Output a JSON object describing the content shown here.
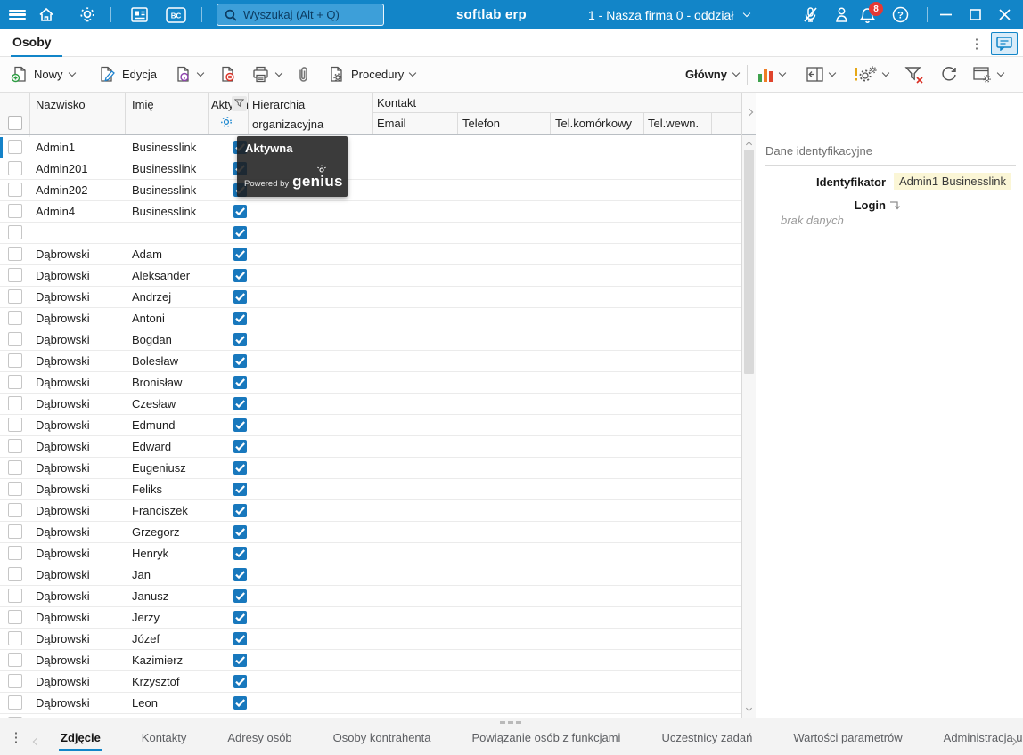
{
  "colors": {
    "topbar_blue": "#1285c8",
    "accent_blue": "#1285c8",
    "checkbox_blue": "#1878bd",
    "highlight_yellow": "#fbf6d6",
    "badge_red": "#e53935",
    "tooltip_bg": "rgba(30,30,30,0.87)"
  },
  "topbar": {
    "brand": "softlab erp",
    "search_placeholder": "Wyszukaj (Alt + Q)",
    "company_selector": "1 - Nasza firma 0 - oddział",
    "notification_count": "8"
  },
  "tabrow": {
    "active_tab": "Osoby"
  },
  "toolbar": {
    "new_label": "Nowy",
    "edit_label": "Edycja",
    "procedures_label": "Procedury",
    "view_label": "Główny"
  },
  "grid": {
    "columns": {
      "nazwisko": "Nazwisko",
      "imie": "Imię",
      "aktywna": "Aktywn",
      "hierarchia_line1": "Hierarchia",
      "hierarchia_line2": "organizacyjna",
      "kontakt_group": "Kontakt",
      "email": "Email",
      "telefon": "Telefon",
      "tel_komorkowy": "Tel.komórkowy",
      "tel_wewn": "Tel.wewn."
    },
    "rows": [
      {
        "nazwisko": "Admin1",
        "imie": "Businesslink",
        "aktywna": true,
        "selected": true
      },
      {
        "nazwisko": "Admin201",
        "imie": "Businesslink",
        "aktywna": true
      },
      {
        "nazwisko": "Admin202",
        "imie": "Businesslink",
        "aktywna": true
      },
      {
        "nazwisko": "Admin4",
        "imie": "Businesslink",
        "aktywna": true
      },
      {
        "nazwisko": "",
        "imie": "",
        "aktywna": true
      },
      {
        "nazwisko": "Dąbrowski",
        "imie": "Adam",
        "aktywna": true
      },
      {
        "nazwisko": "Dąbrowski",
        "imie": "Aleksander",
        "aktywna": true
      },
      {
        "nazwisko": "Dąbrowski",
        "imie": "Andrzej",
        "aktywna": true
      },
      {
        "nazwisko": "Dąbrowski",
        "imie": "Antoni",
        "aktywna": true
      },
      {
        "nazwisko": "Dąbrowski",
        "imie": "Bogdan",
        "aktywna": true
      },
      {
        "nazwisko": "Dąbrowski",
        "imie": "Bolesław",
        "aktywna": true
      },
      {
        "nazwisko": "Dąbrowski",
        "imie": "Bronisław",
        "aktywna": true
      },
      {
        "nazwisko": "Dąbrowski",
        "imie": "Czesław",
        "aktywna": true
      },
      {
        "nazwisko": "Dąbrowski",
        "imie": "Edmund",
        "aktywna": true
      },
      {
        "nazwisko": "Dąbrowski",
        "imie": "Edward",
        "aktywna": true
      },
      {
        "nazwisko": "Dąbrowski",
        "imie": "Eugeniusz",
        "aktywna": true
      },
      {
        "nazwisko": "Dąbrowski",
        "imie": "Feliks",
        "aktywna": true
      },
      {
        "nazwisko": "Dąbrowski",
        "imie": "Franciszek",
        "aktywna": true
      },
      {
        "nazwisko": "Dąbrowski",
        "imie": "Grzegorz",
        "aktywna": true
      },
      {
        "nazwisko": "Dąbrowski",
        "imie": "Henryk",
        "aktywna": true
      },
      {
        "nazwisko": "Dąbrowski",
        "imie": "Jan",
        "aktywna": true
      },
      {
        "nazwisko": "Dąbrowski",
        "imie": "Janusz",
        "aktywna": true
      },
      {
        "nazwisko": "Dąbrowski",
        "imie": "Jerzy",
        "aktywna": true
      },
      {
        "nazwisko": "Dąbrowski",
        "imie": "Józef",
        "aktywna": true
      },
      {
        "nazwisko": "Dąbrowski",
        "imie": "Kazimierz",
        "aktywna": true
      },
      {
        "nazwisko": "Dąbrowski",
        "imie": "Krzysztof",
        "aktywna": true
      },
      {
        "nazwisko": "Dąbrowski",
        "imie": "Leon",
        "aktywna": true
      },
      {
        "nazwisko": "",
        "imie": "",
        "aktywna": true,
        "partial": true
      }
    ]
  },
  "tooltip": {
    "title": "Aktywna",
    "powered_by": "Powered by",
    "brand": "genius"
  },
  "side_panel": {
    "title": "Dane identyfikacyjne",
    "identifier_label": "Identyfikator",
    "identifier_value": "Admin1 Businesslink",
    "login_label": "Login",
    "empty_text": "brak danych"
  },
  "bottom_tabs": {
    "active_index": 0,
    "items": [
      "Zdjęcie",
      "Kontakty",
      "Adresy osób",
      "Osoby kontrahenta",
      "Powiązanie osób z funkcjami",
      "Uczestnicy zadań",
      "Wartości parametrów",
      "Administracja up"
    ]
  },
  "icons": {
    "kebab": "⋮",
    "search": "magnifier",
    "mic_muted": "mic-with-slash",
    "notifications": "bell",
    "help": "question-circle",
    "filter": "funnel",
    "genius": "dashed-lightbulb"
  }
}
